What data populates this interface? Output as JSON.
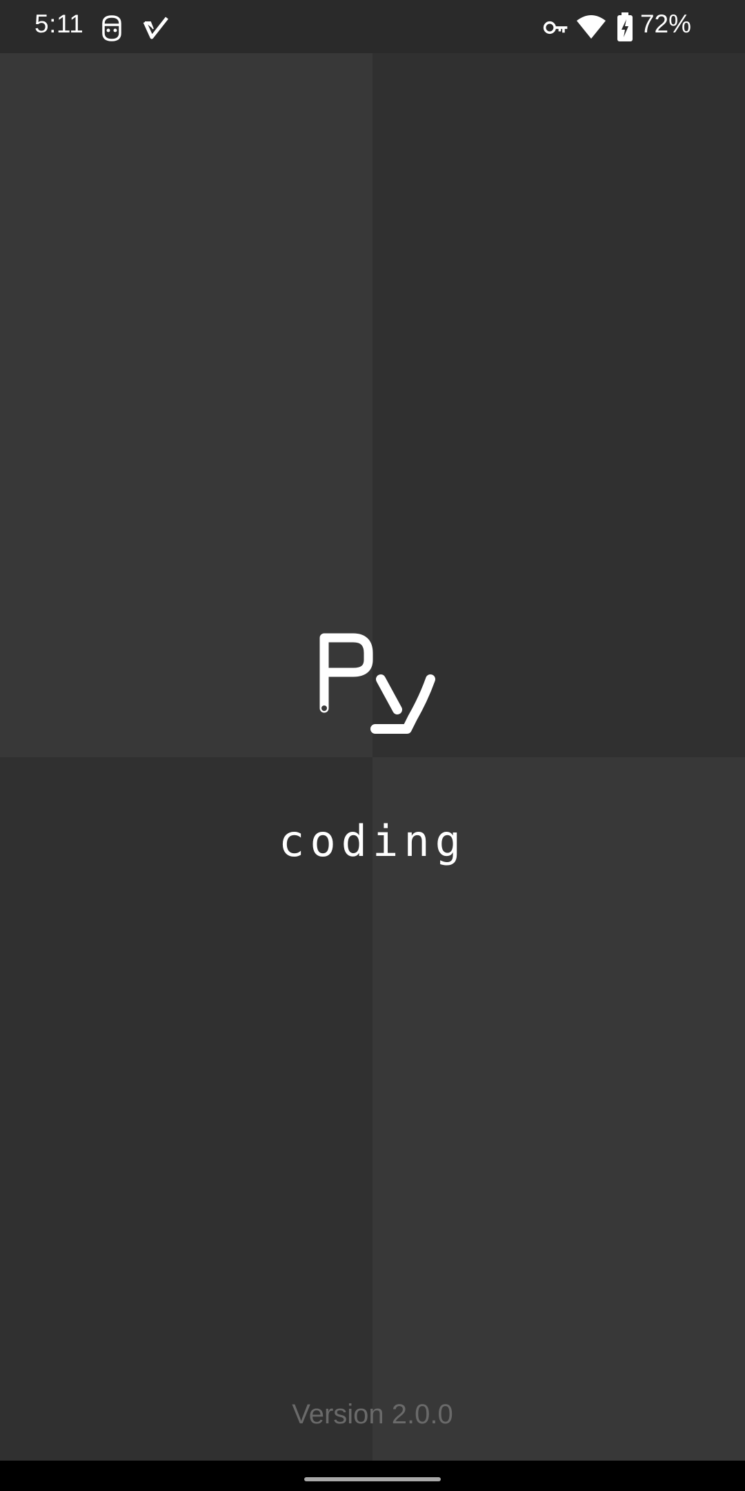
{
  "status_bar": {
    "time": "5:11",
    "battery_percent": "72%",
    "icons": [
      "app-notification-icon",
      "check-notification-icon",
      "vpn-key-icon",
      "wifi-icon",
      "battery-charging-icon"
    ]
  },
  "splash": {
    "logo_text": "Py",
    "tagline": "coding",
    "version": "Version 2.0.0",
    "colors": {
      "quadrant_light": "#383838",
      "quadrant_dark": "#303030",
      "logo": "#ffffff",
      "version_text": "#6a6a6a"
    }
  }
}
